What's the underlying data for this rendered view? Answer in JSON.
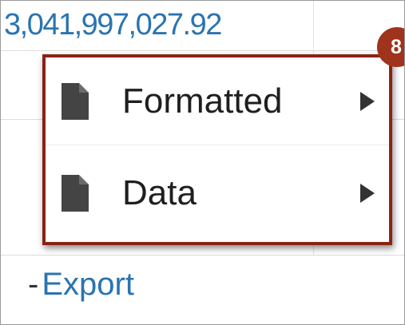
{
  "table": {
    "amount": "3,041,997,027.92"
  },
  "export_menu": {
    "step_badge": "8",
    "items": [
      {
        "label": "Formatted",
        "icon": "document-icon",
        "submenu_icon": "chevron-right-icon"
      },
      {
        "label": "Data",
        "icon": "document-icon",
        "submenu_icon": "chevron-right-icon"
      }
    ],
    "highlight_color": "#8b2213",
    "badge_color": "#a0331b"
  },
  "footer": {
    "dash": "-",
    "export_link": "Export"
  },
  "colors": {
    "link": "#2a74b0",
    "text": "#1f1f1f",
    "icon": "#444444"
  }
}
